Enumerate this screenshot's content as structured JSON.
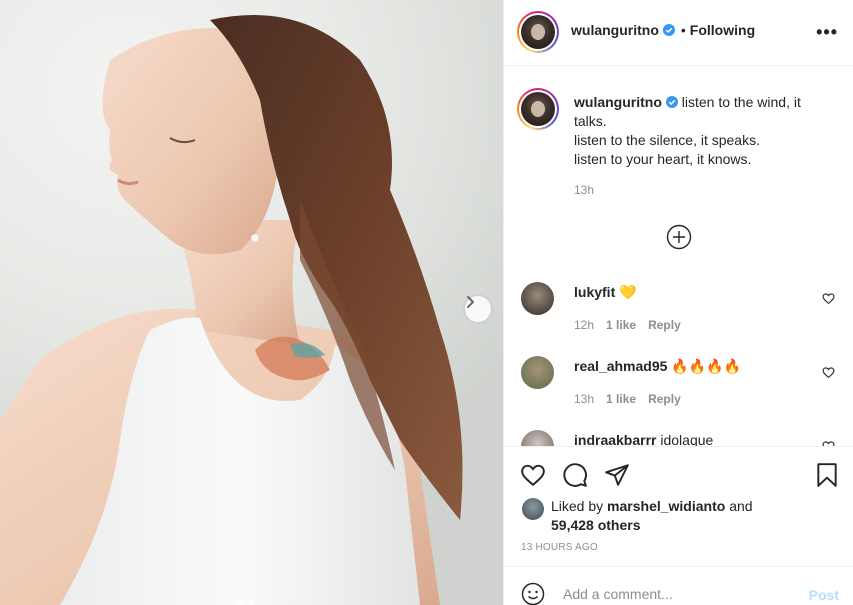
{
  "post": {
    "author": "wulanguritno",
    "follow_separator": "•",
    "follow_status": "Following",
    "more_label": "•••"
  },
  "caption": {
    "author": "wulanguritno",
    "lines": [
      "listen to the wind, it talks.",
      "listen to the silence, it speaks.",
      "listen to your heart, it knows."
    ],
    "time": "13h"
  },
  "comments": [
    {
      "user": "lukyfit",
      "emoji": "💛",
      "text": "",
      "time": "12h",
      "likes": "1 like",
      "reply": "Reply"
    },
    {
      "user": "real_ahmad95",
      "emoji": "🔥🔥🔥🔥",
      "text": "",
      "time": "13h",
      "likes": "1 like",
      "reply": "Reply"
    },
    {
      "user": "indraakbarrr",
      "text": "idolaque",
      "time": "",
      "likes": "",
      "reply": ""
    }
  ],
  "likes": {
    "prefix": "Liked by",
    "user": "marshel_widianto",
    "connector": "and",
    "count": "59,428 others"
  },
  "posted_ago": "13 HOURS AGO",
  "comment_input": {
    "placeholder": "Add a comment...",
    "post_label": "Post"
  },
  "icons": {
    "like": "heart-icon",
    "comment": "comment-bubble-icon",
    "share": "paper-plane-icon",
    "save": "bookmark-icon",
    "emoji": "emoji-icon",
    "verified": "verified-badge-icon",
    "next": "chevron-right-icon",
    "add": "add-circle-icon"
  },
  "colors": {
    "text": "#262626",
    "muted": "#8e8e8e",
    "verified": "#3897f0",
    "post_button_disabled": "#b2dffc",
    "border": "#efefef"
  }
}
